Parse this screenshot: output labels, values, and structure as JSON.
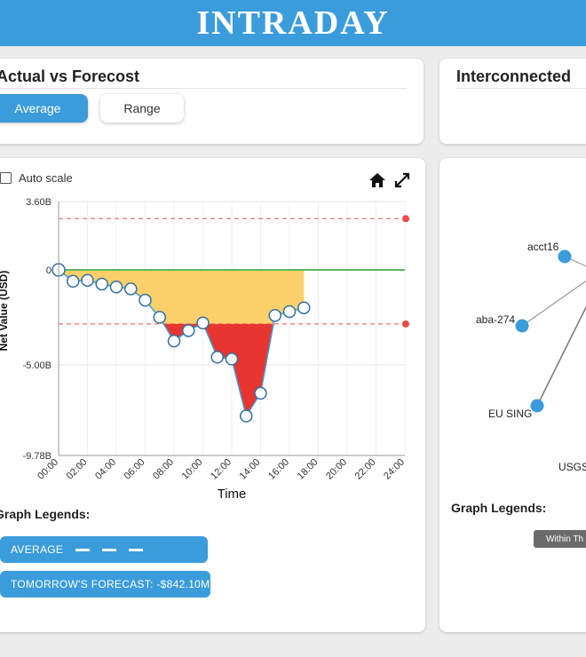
{
  "header": {
    "title": "INTRADAY"
  },
  "actual_card": {
    "title": "Actual vs Forecost",
    "buttons": {
      "average": "Average",
      "range": "Range"
    }
  },
  "interconnected_card": {
    "title": "Interconnected"
  },
  "chart_panel": {
    "auto_scale_label": "Auto scale",
    "icons": [
      "home-icon",
      "expand-icon"
    ],
    "legend_title": "Graph Legends:",
    "legend_average": "AVERAGE",
    "legend_forecast": "TOMORROW'S FORECAST: -$842.10M"
  },
  "chart_data": {
    "type": "area",
    "xlabel": "Time",
    "ylabel": "Net Value (USD)",
    "x_ticks": [
      "00:00",
      "02:00",
      "04:00",
      "06:00",
      "08:00",
      "10:00",
      "12:00",
      "14:00",
      "16:00",
      "18:00",
      "20:00",
      "22:00",
      "24:00"
    ],
    "y_ticks": [
      "3.60B",
      "0",
      "-5.00B",
      "-9.78B"
    ],
    "ylim": [
      -9.78,
      3.6
    ],
    "xlim": [
      0,
      24
    ],
    "units": "billion USD",
    "zero_line_color": "#5cb85c",
    "thresholds": [
      2.7,
      -2.85
    ],
    "threshold_color": "#ef4a4a",
    "fill_within_color": "#fbd06a",
    "fill_beyond_color": "#e8352f",
    "series": [
      {
        "values": [
          [
            0.0,
            0.0
          ],
          [
            1.0,
            -0.6
          ],
          [
            2.0,
            -0.55
          ],
          [
            3.0,
            -0.75
          ],
          [
            4.0,
            -0.9
          ],
          [
            5.0,
            -1.0
          ],
          [
            6.0,
            -1.6
          ],
          [
            7.0,
            -2.5
          ],
          [
            8.0,
            -3.75
          ],
          [
            9.0,
            -3.2
          ],
          [
            10.0,
            -2.8
          ],
          [
            11.0,
            -4.6
          ],
          [
            12.0,
            -4.7
          ],
          [
            13.0,
            -7.7
          ],
          [
            14.0,
            -6.5
          ],
          [
            15.0,
            -2.4
          ],
          [
            16.0,
            -2.2
          ],
          [
            17.0,
            -2.0
          ]
        ]
      }
    ]
  },
  "network_panel": {
    "legend_title": "Graph Legends:",
    "chip_label": "Within Th",
    "nodes": [
      {
        "label": "acct16"
      },
      {
        "label": "aba-274"
      },
      {
        "label": "EU SING"
      },
      {
        "label": "USGS"
      }
    ],
    "node_color": "#3b9cdc"
  }
}
